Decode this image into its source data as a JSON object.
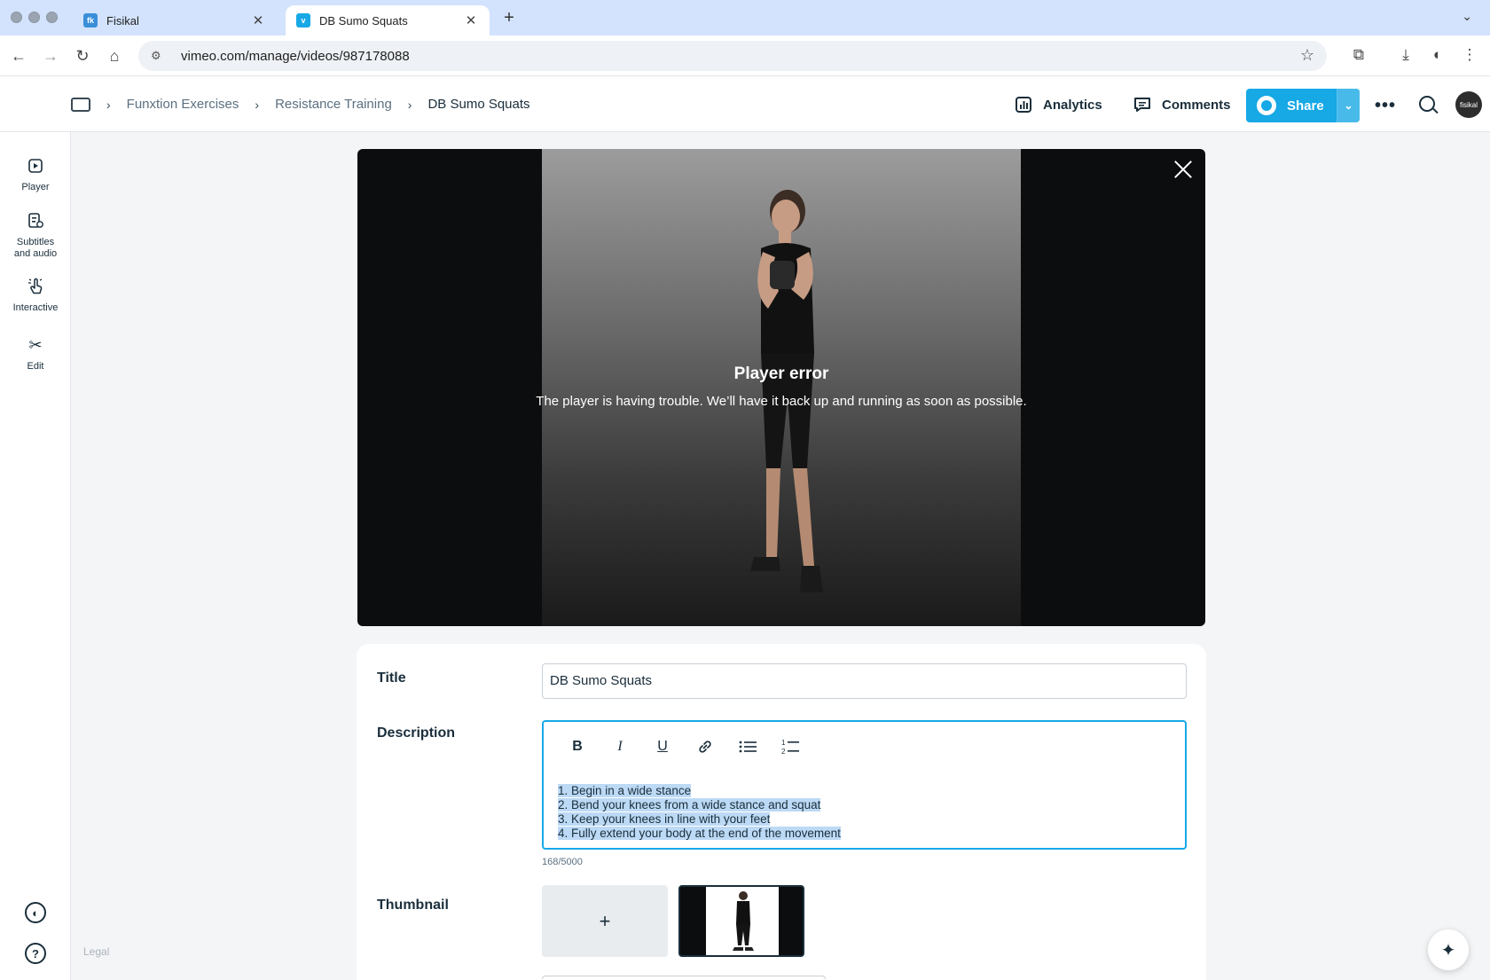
{
  "browser": {
    "tabs": [
      {
        "title": "Fisikal",
        "favicon": "fisikal-icon",
        "active": false
      },
      {
        "title": "DB Sumo Squats",
        "favicon": "vimeo-icon",
        "active": true
      }
    ],
    "url": "vimeo.com/manage/videos/987178088"
  },
  "header": {
    "breadcrumbs": [
      "Funxtion Exercises",
      "Resistance Training",
      "DB Sumo Squats"
    ],
    "analytics_label": "Analytics",
    "comments_label": "Comments",
    "share_label": "Share",
    "avatar_text": "fisikal"
  },
  "rail": {
    "items": [
      {
        "label": "Player",
        "icon": "play-icon"
      },
      {
        "label": "Subtitles and audio",
        "icon": "subtitles-icon"
      },
      {
        "label": "Interactive",
        "icon": "interactive-icon"
      },
      {
        "label": "Edit",
        "icon": "scissors-icon"
      }
    ],
    "legal": "Legal"
  },
  "player": {
    "error_title": "Player error",
    "error_message": "The player is having trouble. We’ll have it back up and running as soon as possible."
  },
  "details": {
    "title_label": "Title",
    "title_value": "DB Sumo Squats",
    "description_label": "Description",
    "description_lines": [
      "1. Begin in a wide stance",
      "2. Bend your knees from a wide stance and squat",
      "3. Keep your knees in line with your feet",
      "4. Fully extend your body at the end of the movement"
    ],
    "char_count": "168/5000",
    "thumbnail_label": "Thumbnail",
    "add_thumbnail": "+"
  },
  "colors": {
    "accent": "#17a8e6",
    "selection": "#bcd9f5",
    "tabbar": "#d3e3fd"
  }
}
